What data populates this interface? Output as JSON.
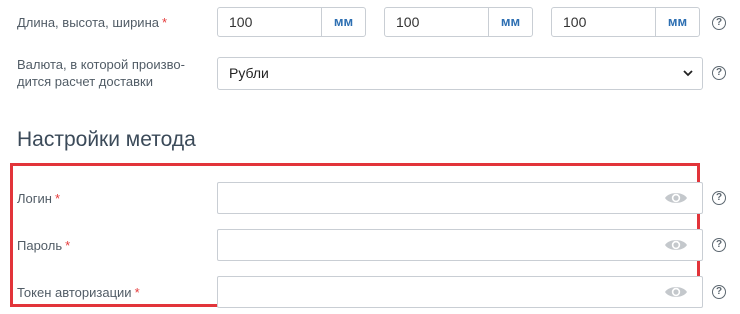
{
  "dimensions": {
    "label": "Длина, высота, ширина",
    "required_mark": "*",
    "fields": [
      {
        "value": "100",
        "unit": "мм"
      },
      {
        "value": "100",
        "unit": "мм"
      },
      {
        "value": "100",
        "unit": "мм"
      }
    ],
    "help": "?"
  },
  "currency": {
    "label_line1": "Валюта, в которой произво-",
    "label_line2": "дится расчет доставки",
    "selected": "Рубли",
    "help": "?"
  },
  "method_settings": {
    "title": "Настройки метода",
    "login": {
      "label": "Логин",
      "required_mark": "*",
      "value": "",
      "help": "?"
    },
    "password": {
      "label": "Пароль",
      "required_mark": "*",
      "value": "",
      "help": "?"
    },
    "token": {
      "label": "Токен авторизации",
      "required_mark": "*",
      "value": "",
      "help": "?"
    }
  },
  "colors": {
    "accent_unit": "#2d6fb2",
    "required": "#e53b3b",
    "highlight_border": "#e2343a"
  }
}
